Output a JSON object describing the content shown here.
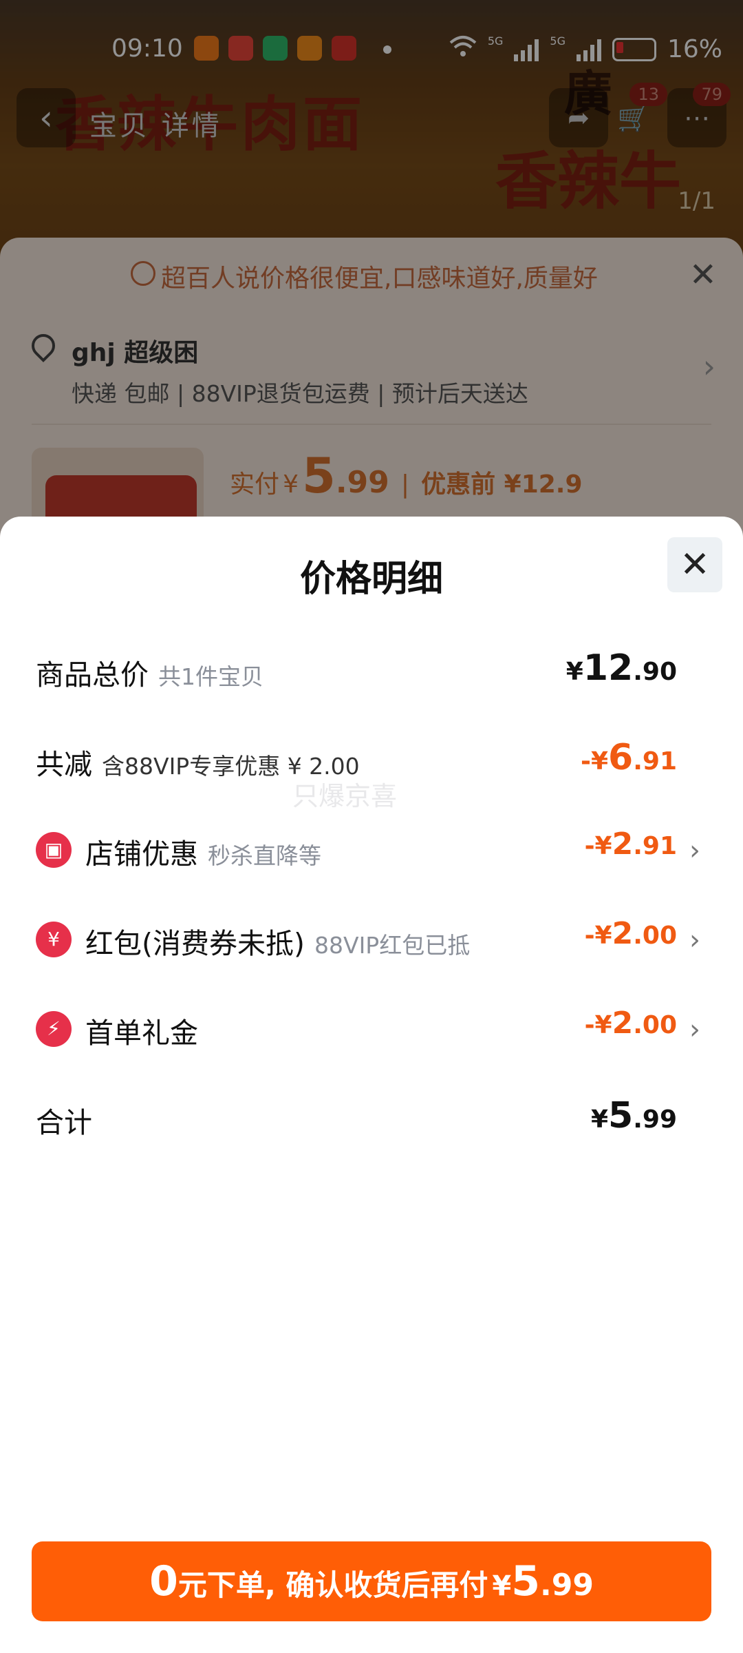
{
  "status_bar": {
    "time": "09:10",
    "battery": "16%",
    "net1": "5G",
    "net2": "5G"
  },
  "background": {
    "product_name": "香辣牛肉面",
    "nav_tabs": "宝贝 详情",
    "cart_count": "13",
    "msg_count": "79",
    "image_counter": "1/1",
    "tip": "超百人说价格很便宜,口感味道好,质量好",
    "address_name": "ghj 超级困",
    "shipping_info": "快递 包邮 | 88VIP退货包运费 | 预计后天送达",
    "paid_label": "实付",
    "paid_currency": "¥",
    "paid_int": "5",
    "paid_dec": ".99",
    "before_discount": "优惠前 ¥12.9"
  },
  "sheet": {
    "title": "价格明细",
    "watermark": "只爆京喜",
    "rows": [
      {
        "label": "商品总价",
        "sub": "共1件宝贝",
        "cur": "¥",
        "int": "12",
        "dec": ".90"
      },
      {
        "label": "共减",
        "sub": "含88VIP专享优惠 ¥ 2.00",
        "cur": "-¥",
        "int": "6",
        "dec": ".91"
      },
      {
        "label": "店铺优惠",
        "sub": "秒杀直降等",
        "cur": "-¥",
        "int": "2",
        "dec": ".91",
        "icon": "shop-icon"
      },
      {
        "label": "红包(消费券未抵)",
        "sub": "88VIP红包已抵",
        "cur": "-¥",
        "int": "2",
        "dec": ".00",
        "icon": "red-packet-icon"
      },
      {
        "label": "首单礼金",
        "sub": "",
        "cur": "-¥",
        "int": "2",
        "dec": ".00",
        "icon": "lightning-icon"
      },
      {
        "label": "合计",
        "sub": "",
        "cur": "¥",
        "int": "5",
        "dec": ".99"
      }
    ]
  },
  "bottom_button": {
    "big": "0",
    "text": "元下单, 确认收货后再付",
    "cur": "¥",
    "int": "5",
    "dec": ".99"
  },
  "colors": {
    "accent": "#ff5e06",
    "discount": "#f05a12",
    "icon_red": "#e6304a"
  }
}
